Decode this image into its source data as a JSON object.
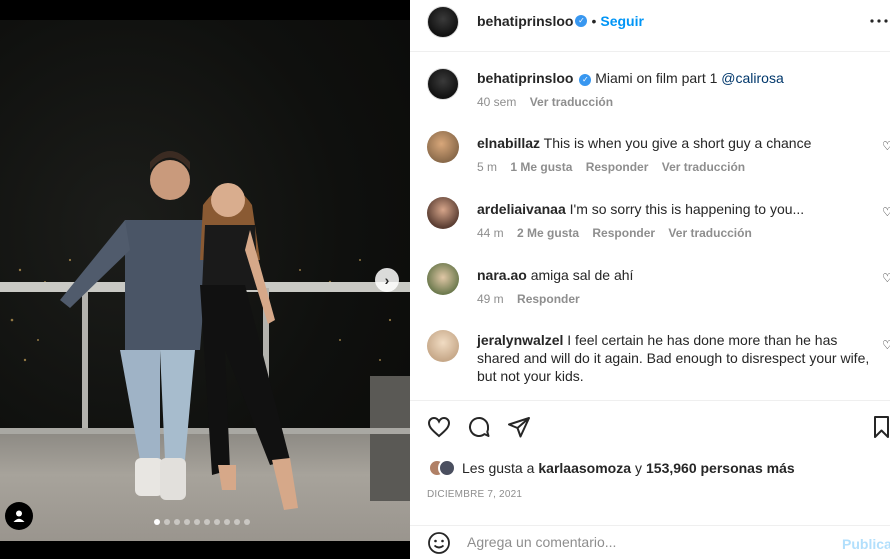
{
  "post": {
    "username": "behatiprinsloo",
    "follow_label": "Seguir",
    "separator": "•",
    "caption_text": "Miami on film part 1",
    "caption_mention": "@calirosa",
    "caption_age": "40 sem",
    "see_translation": "Ver traducción"
  },
  "carousel": {
    "next_arrow": "›",
    "dot_count": 10,
    "active_dot": 0
  },
  "comments": [
    {
      "username": "elnabillaz",
      "text": "This is when you give a short guy a chance",
      "age": "5 m",
      "likes": "1 Me gusta",
      "reply": "Responder",
      "translate": "Ver traducción",
      "avatar_color": "#8a6a4a"
    },
    {
      "username": "ardeliaivanaa",
      "text": "I'm so sorry this is happening to you...",
      "age": "44 m",
      "likes": "2 Me gusta",
      "reply": "Responder",
      "translate": "Ver traducción",
      "avatar_color": "#5b3e33"
    },
    {
      "username": "nara.ao",
      "text": "amiga sal de ahí",
      "age": "49 m",
      "likes": "",
      "reply": "Responder",
      "translate": "",
      "avatar_color": "#6d7a4e"
    },
    {
      "username": "jeralynwalzel",
      "text": "I feel certain he has done more than he has shared and will do it again. Bad enough to disrespect your wife, but not your kids.",
      "age": "",
      "likes": "",
      "reply": "",
      "translate": "",
      "avatar_color": "#c7a98a"
    }
  ],
  "likes_line": {
    "prefix": "Les gusta a",
    "user": "karlaasomoza",
    "middle": "y",
    "count": "153,960 personas más"
  },
  "date": "DICIEMBRE 7, 2021",
  "composer": {
    "placeholder": "Agrega un comentario...",
    "publish_label": "Publicar"
  },
  "colors": {
    "accent": "#0095f6",
    "verified": "#3897f0",
    "muted_text": "#8e8e8e"
  }
}
